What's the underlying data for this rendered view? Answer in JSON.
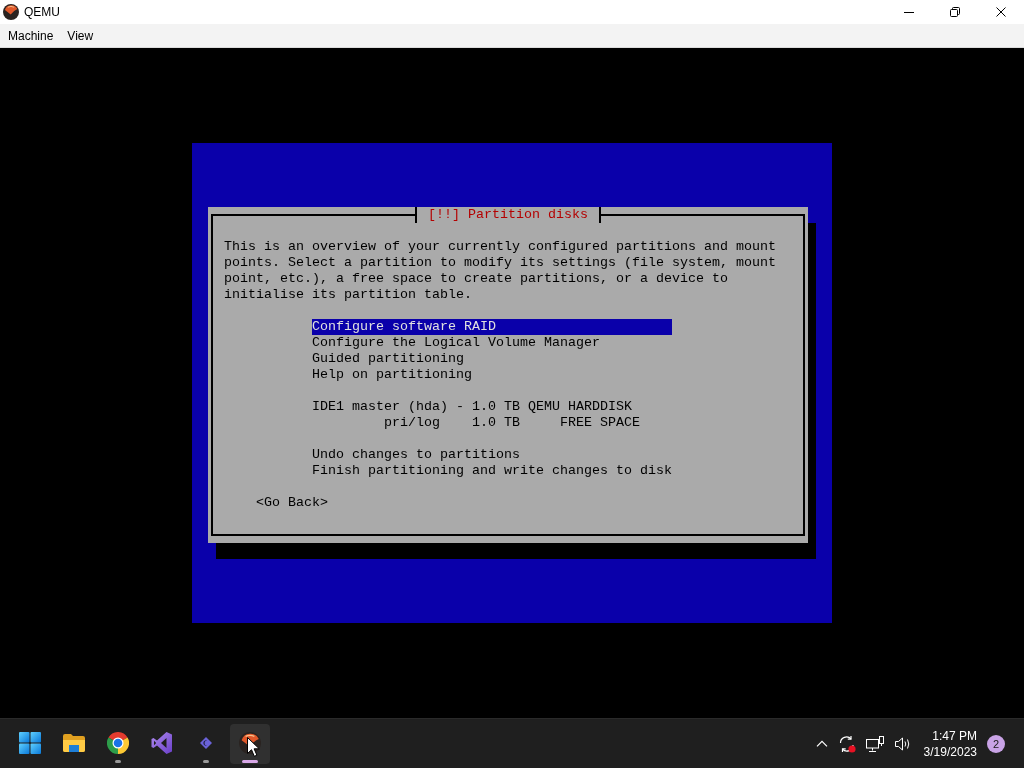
{
  "window": {
    "title": "QEMU"
  },
  "menu_bar": [
    {
      "label": "Machine"
    },
    {
      "label": "View"
    }
  ],
  "installer": {
    "title": "[!!] Partition disks",
    "description": "This is an overview of your currently configured partitions and mount points. Select a partition to modify its settings (file system, mount point, etc.), a free space to create partitions, or a device to initialise its partition table.",
    "sections": [
      {
        "items": [
          {
            "kind": "action",
            "label": "Configure software RAID",
            "selected": true
          },
          {
            "kind": "action",
            "label": "Configure the Logical Volume Manager",
            "selected": false
          },
          {
            "kind": "action",
            "label": "Guided partitioning",
            "selected": false
          },
          {
            "kind": "action",
            "label": "Help on partitioning",
            "selected": false
          }
        ]
      },
      {
        "items": [
          {
            "kind": "disk",
            "label": "IDE1 master (hda) - 1.0 TB QEMU HARDDISK",
            "selected": false
          },
          {
            "kind": "partition",
            "label": "pri/log    1.0 TB     FREE SPACE",
            "selected": false
          }
        ]
      },
      {
        "items": [
          {
            "kind": "action",
            "label": "Undo changes to partitions",
            "selected": false
          },
          {
            "kind": "action",
            "label": "Finish partitioning and write changes to disk",
            "selected": false
          }
        ]
      }
    ],
    "back_button": "<Go Back>"
  },
  "taskbar": {
    "apps": [
      {
        "kind": "start",
        "running": false,
        "active": false
      },
      {
        "kind": "folder",
        "running": false,
        "active": false
      },
      {
        "kind": "browser",
        "running": true,
        "active": false
      },
      {
        "kind": "ide",
        "running": false,
        "active": false
      },
      {
        "kind": "diamond",
        "running": true,
        "active": false
      },
      {
        "kind": "emulator",
        "running": true,
        "active": true
      }
    ],
    "tray": {
      "time": "1:47 PM",
      "date": "3/19/2023",
      "notifications": "2"
    }
  }
}
